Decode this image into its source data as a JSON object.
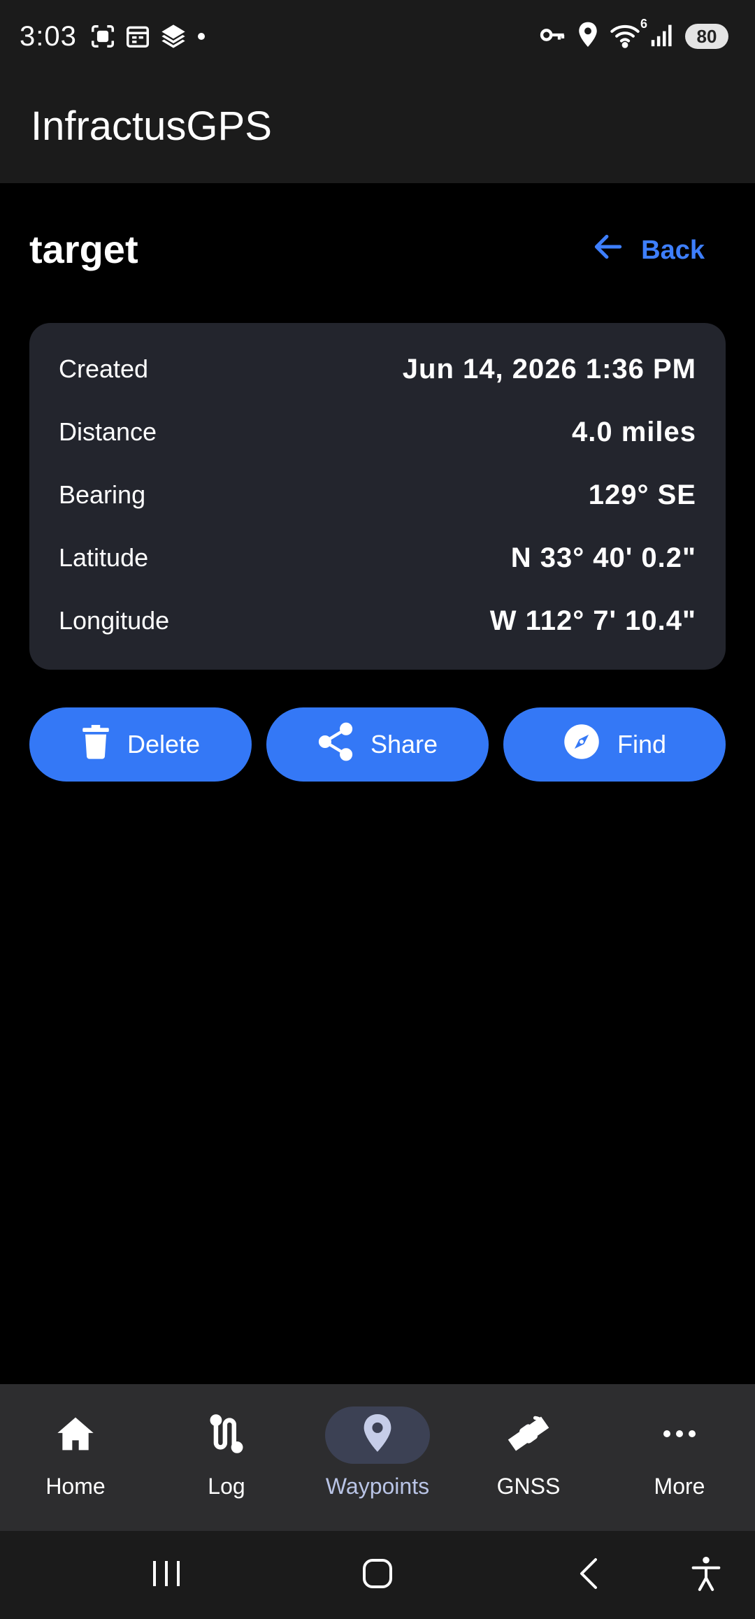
{
  "status_bar": {
    "time": "3:03",
    "battery": "80",
    "wifi_generation": "6",
    "left_icons": [
      "screenshot-icon",
      "calendar-icon",
      "stack-icon",
      "dot-icon"
    ],
    "right_icons": [
      "vpn-key-icon",
      "location-icon",
      "wifi-icon",
      "signal-icon"
    ]
  },
  "app": {
    "title": "InfractusGPS"
  },
  "page": {
    "waypoint_name": "target",
    "back_label": "Back"
  },
  "details": {
    "rows": [
      {
        "label": "Created",
        "value": "Jun 14, 2026 1:36 PM"
      },
      {
        "label": "Distance",
        "value": "4.0 miles"
      },
      {
        "label": "Bearing",
        "value": "129° SE"
      },
      {
        "label": "Latitude",
        "value": "N 33° 40' 0.2\""
      },
      {
        "label": "Longitude",
        "value": "W 112° 7' 10.4\""
      }
    ]
  },
  "actions": {
    "delete_label": "Delete",
    "share_label": "Share",
    "find_label": "Find"
  },
  "bottom_nav": {
    "items": [
      {
        "label": "Home",
        "icon": "home-icon"
      },
      {
        "label": "Log",
        "icon": "route-icon"
      },
      {
        "label": "Waypoints",
        "icon": "map-pin-icon",
        "active": true
      },
      {
        "label": "GNSS",
        "icon": "satellite-icon"
      },
      {
        "label": "More",
        "icon": "more-horizontal-icon"
      }
    ]
  },
  "colors": {
    "accent": "#3478f6",
    "back_link": "#3e7fff",
    "card": "#23252d",
    "bar": "#1b1b1b",
    "bottom_nav": "#2d2d2f",
    "active_pill": "#3c4154"
  }
}
